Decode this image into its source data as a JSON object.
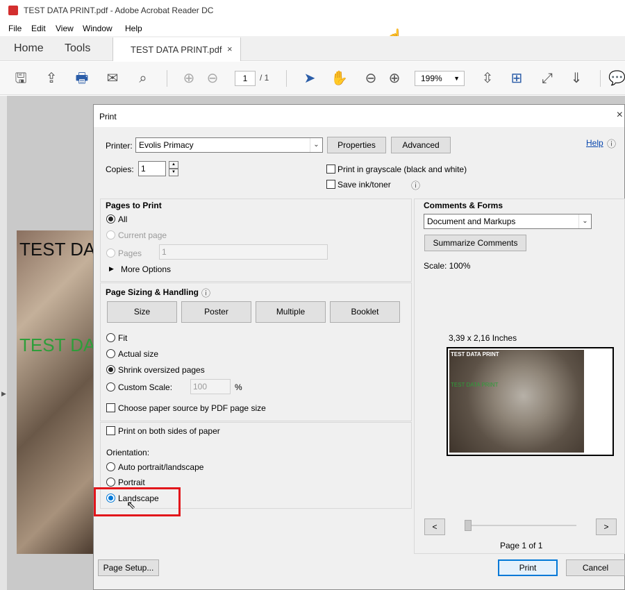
{
  "window": {
    "title": "TEST DATA PRINT.pdf - Adobe Acrobat Reader DC"
  },
  "menu": [
    "File",
    "Edit",
    "View",
    "Window",
    "Help"
  ],
  "tabs": {
    "home": "Home",
    "tools": "Tools",
    "document": "TEST DATA PRINT.pdf",
    "close": "×"
  },
  "toolbar": {
    "page_current": "1",
    "page_total": "/ 1",
    "zoom": "199%"
  },
  "document_preview": {
    "text_black": "TEST DA",
    "text_green": "TEST DA"
  },
  "dialog": {
    "title": "Print",
    "close": "×",
    "printer_label": "Printer:",
    "printer_value": "Evolis Primacy",
    "properties_button": "Properties",
    "advanced_button": "Advanced",
    "help_link": "Help",
    "copies_label": "Copies:",
    "copies_value": "1",
    "grayscale_label": "Print in grayscale (black and white)",
    "save_ink_label": "Save ink/toner",
    "pages_to_print": {
      "heading": "Pages to Print",
      "all": "All",
      "current_page": "Current page",
      "pages": "Pages",
      "pages_value": "1",
      "more_options": "More Options"
    },
    "sizing": {
      "heading": "Page Sizing & Handling",
      "buttons": [
        "Size",
        "Poster",
        "Multiple",
        "Booklet"
      ],
      "fit": "Fit",
      "actual_size": "Actual size",
      "shrink": "Shrink oversized pages",
      "custom_scale": "Custom Scale:",
      "custom_scale_value": "100",
      "percent": "%",
      "paper_source": "Choose paper source by PDF page size"
    },
    "both_sides": "Print on both sides of paper",
    "orientation": {
      "heading": "Orientation:",
      "auto": "Auto portrait/landscape",
      "portrait": "Portrait",
      "landscape": "Landscape"
    },
    "comments": {
      "heading": "Comments & Forms",
      "value": "Document and Markups",
      "summarize": "Summarize Comments"
    },
    "scale_label": "Scale: 100%",
    "paper_size": "3,39 x 2,16 Inches",
    "preview_text_black": "TEST DATA PRINT",
    "preview_text_green": "TEST DATA PRINT",
    "prev_button": "<",
    "next_button": ">",
    "page_indicator": "Page 1 of 1",
    "page_setup_button": "Page Setup...",
    "print_button": "Print",
    "cancel_button": "Cancel"
  },
  "colors": {
    "highlight": "#e2161b",
    "accent": "#0078d7",
    "green_text": "#2e9e3a"
  }
}
